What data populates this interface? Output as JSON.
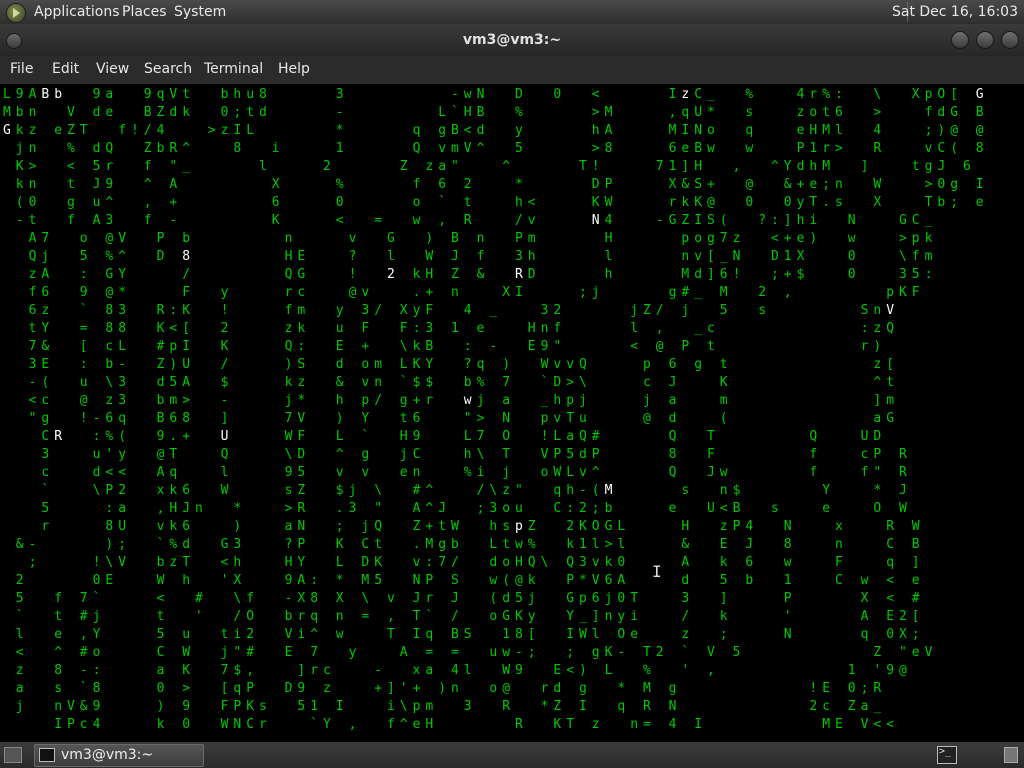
{
  "top_panel": {
    "menus": [
      "Applications",
      "Places",
      "System"
    ],
    "clock": "Sat Dec 16, 16:03"
  },
  "window": {
    "title": "vm3@vm3:~",
    "menus": [
      "File",
      "Edit",
      "View",
      "Search",
      "Terminal",
      "Help"
    ]
  },
  "terminal": {
    "text_color": "#00c800",
    "highlight_color": "#ffffff",
    "lines": [
      "L9ABb  9a  9qVt  bhu8     3        -wN  D  0  <     IzC_  %   4r%:  \\  XpO[ G",
      "Mbn  V de  BZdk  0;td     -       L`HB  %     >M    ,qU*  s   zot6  >   fdG B",
      "Gkz eZT  f!/4   >zIL      *     q gB<d  y     hA    MINo  q   eHMl  4   ;)@ @",
      " jn  % dQ  ZbR^   8  i    1     Q vmV^  5     >8    6eBw  w   P1r>  R   vC( 8",
      " K>  < 5r  f \"_     l    2     Z za\"   ^     T!    71]H  ,  ^YdhM  ]   tgJ 6",
      " kn  t J9  ^ A       X    %     f 6 2   *     DP    X&S+  @  &+e;n  W   >0g I",
      " (0  g u^  , +       6    0     o ` t   h<    KW    rkK@  0  0yT.s  X   Tb; e",
      " -t  f A3  f -       K    <  =  w , R   /v    N4   -GZIS(  ?:]hi  N   GC_ ",
      "  A7  o @V  P b       n    v  G  ) B n  Pm     H     pog7z  <+e)  w   >pk ",
      "  Qj  5 %^  D 8       HE   ?  l  W J f  3h     l     nv[_N  D1X   0   \\fm ",
      "  zA  : GY    /       QG   !  2 kH Z &  RD     h     Md]6!  ;+$   0   35: ",
      "  f6  9 @*    F  y    rc   @v   .+ n   XI    ;j     g#_ M  2 ,       pKF ",
      "  6z  ` 83  R:K  !    fm  y 3/ XyF  4 _   32     jZ/ j  5  s       SnV ",
      "  tY  = 88  K<[  2    zk  u F  F:3 1 e   Hnf     l ,  _c           :zQ ",
      "  7&  [ cL  #pI  K    Q:  E +  \\kB  : -  E9\"     < @ P t           r) ",
      "  3E  : b-  Z)U  /    )S  d om LKY  ?q )  WvvQ    p 6 g t           z[ ",
      "  -(  u \\3  d5A  $    kz  & vn `$$  b% 7  `D>\\    c J   K           ^t ",
      "  <c  @ z3  bm>  -    j*  h p/ g+r  wj a  _hpj    j a   m           ]m ",
      "  \"g  !-6q  B68  ]    7V  ) Y  t6   \"> N  pvTu    @ d   (           aG ",
      "   CR  :%(  9.+  U    WF  L `  H9   L7 O  !LaQ#     Q  T       Q   UD ",
      "   3   u'y  @T   Q    \\D  ^ g  jC   h\\ T  VP5dP     8  F       f   cP R",
      "   c   d<<  Aq   l    95  v v  en   %i j  oWLv^     Q  Jw      f   f\" R",
      "   `   \\P2  xk6  W    sZ  $j \\  #^   /\\z\"  qh-(M     s  n$      Y   * J",
      "   5    :a  ,HJn  *   >R  .3 \"  A^J  ;3ou  C:2;b    e  U<B  s   e   O W",
      "   r    8U  vk6   )   aN  ; jQ  Z+tW  hspZ  2KOGL    H  zP4  N   x   R W",
      " &-     );  `%d  G3   ?P  K Ct  .Mgb  Ltw%  k1l>l    &  E J  8   n   C B",
      "  ;    !\\V  bzT  <h   HY  L DK  v:7/  doHQ\\ Q3vk0    A  k 6  w   F   q ]",
      " 2     0E   W h  'X   9A: * M5  NP S  w(@k  P*V6A    d  5 b  1   C w < e",
      " 5  f 7`    <  #  \\f  -X8 X \\ v Jr J  (d5j  Gp6j0T   3  ]    P     X < #",
      " `  t #j    t  '  /O  brq n = , T` /  oGKy  Y_]nyi   /  k    '     A E2[",
      " l  e ,Y    5 u  ti2  Vi^ w   T Iq BS  18[  IWl Oe   z  ;    N     q 0X;",
      " <  ^ #o    C W  j\"#  E 7  y   A = =  uw-;  ; gK- T2 ` V 5          Z \"eV",
      " z  8 -:    a K  7$,   ]rc   -  xa 4l  W9  E<) L  %  ' ,          1 '9@",
      " a  s `8    0 >  [qP  D9 z   +]'+ )n  o@  rd g  * M g          !E 0;R",
      " j  nV&9    ) 9  FPKs  51 I   i\\pm  3  R  *Z I  q R N          2c Za_",
      "    IPc4    k 0  WNCr   `Y ,  f^eH      R  KT z  n= 4 I         ME V<<"
    ],
    "highlights": [
      [
        0,
        3
      ],
      [
        0,
        4
      ],
      [
        0,
        50
      ],
      [
        0,
        53
      ],
      [
        0,
        76
      ],
      [
        1,
        23
      ],
      [
        2,
        0
      ],
      [
        2,
        28
      ],
      [
        2,
        38
      ],
      [
        3,
        17
      ],
      [
        3,
        22
      ],
      [
        4,
        21
      ],
      [
        4,
        37
      ],
      [
        7,
        46
      ],
      [
        9,
        14
      ],
      [
        10,
        30
      ],
      [
        10,
        40
      ],
      [
        11,
        41
      ],
      [
        12,
        30
      ],
      [
        12,
        37
      ],
      [
        12,
        62
      ],
      [
        12,
        69
      ],
      [
        13,
        46
      ],
      [
        15,
        62
      ],
      [
        17,
        30
      ],
      [
        17,
        36
      ],
      [
        19,
        4
      ],
      [
        19,
        17
      ],
      [
        21,
        40
      ],
      [
        22,
        47
      ],
      [
        24,
        40
      ]
    ]
  }
}
